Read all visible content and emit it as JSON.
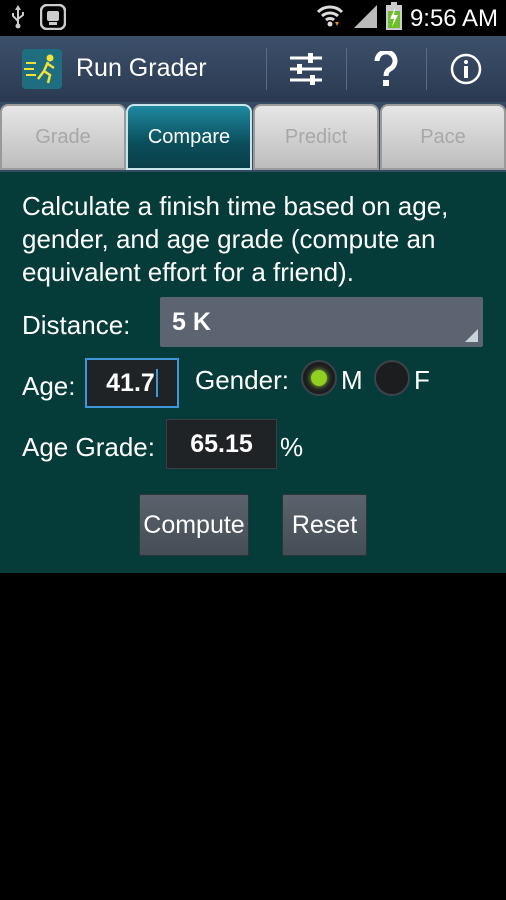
{
  "status_bar": {
    "time": "9:56 AM",
    "icons": [
      "usb-icon",
      "notification-app-icon",
      "wifi-icon",
      "signal-icon",
      "battery-charging-icon"
    ]
  },
  "action_bar": {
    "app_title": "Run Grader",
    "icons": [
      "app-logo-icon",
      "settings-sliders-icon",
      "help-icon",
      "info-icon"
    ]
  },
  "tabs": [
    {
      "label": "Grade",
      "active": false
    },
    {
      "label": "Compare",
      "active": true
    },
    {
      "label": "Predict",
      "active": false
    },
    {
      "label": "Pace",
      "active": false
    }
  ],
  "compare": {
    "description": "Calculate a finish time based on age, gender, and age grade (compute an equivalent effort for a friend).",
    "distance_label": "Distance:",
    "distance_value": "5 K",
    "age_label": "Age:",
    "age_value": "41.7",
    "gender_label": "Gender:",
    "gender_options": [
      {
        "label": "M",
        "selected": true
      },
      {
        "label": "F",
        "selected": false
      }
    ],
    "age_grade_label": "Age Grade:",
    "age_grade_value": "65.15",
    "age_grade_unit": "%",
    "compute_label": "Compute",
    "reset_label": "Reset"
  },
  "colors": {
    "content_bg": "#053b38",
    "action_bar": "#34465f",
    "radio_selected": "#8fd020",
    "focus": "#3f97d9"
  }
}
